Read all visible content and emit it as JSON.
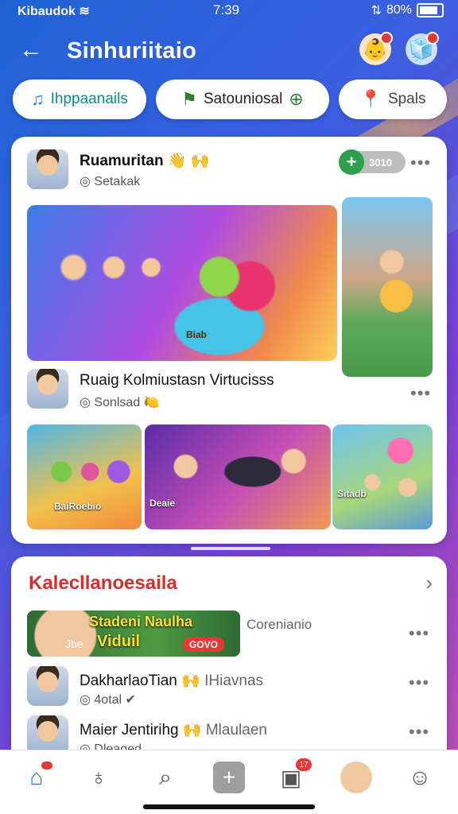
{
  "status_bar": {
    "carrier": "Kibaudok",
    "time": "7:39",
    "battery": "80%"
  },
  "header": {
    "back_icon": "arrow-left-icon",
    "title": "Sinhuriitaio"
  },
  "pills": [
    {
      "label": "Ihppaanails",
      "icon": "music-note-icon"
    },
    {
      "label": "Satouniosal",
      "icon": "compass-icon"
    },
    {
      "label": "Spals",
      "icon": "pin-icon"
    }
  ],
  "post1": {
    "name": "Ruamuritan",
    "emoji": "👋 🙌",
    "subtitle": "Setakak",
    "follow_label": "3010",
    "more": "•••",
    "image_label": "Biab"
  },
  "post2": {
    "name": "Ruaig Kolmiustasn Virtucisss",
    "subtitle": "Sonlsad",
    "emoji": "🍋",
    "more": "•••",
    "images": [
      {
        "label": "BaiRoebio"
      },
      {
        "label": "Deaie"
      },
      {
        "label": "Sitadb"
      }
    ]
  },
  "section": {
    "title": "Kalecllanoesaila",
    "banner": {
      "title_line1": "Stadeni Naulha",
      "title_line2": "Viduil",
      "small": "Jbe",
      "badge": "GOVO"
    },
    "banner_caption": "Corenianio",
    "items": [
      {
        "name": "DakharlaoTian",
        "emoji": "🙌",
        "extra": "IHiavnas",
        "subtitle": "4otal",
        "more": "•••"
      },
      {
        "name": "Maier Jentirihg",
        "emoji": "🙌",
        "extra": "Mlaulaen",
        "subtitle": "Dleaged",
        "more": "•••"
      }
    ]
  },
  "bottom_nav": {
    "items": [
      {
        "icon": "home-icon",
        "badge": ""
      },
      {
        "icon": "tooth-icon",
        "badge": ""
      },
      {
        "icon": "search-icon",
        "badge": ""
      },
      {
        "icon": "add-icon",
        "badge": ""
      },
      {
        "icon": "calendar-icon",
        "badge": "17"
      },
      {
        "icon": "avatar-icon",
        "badge": ""
      },
      {
        "icon": "profile-icon",
        "badge": ""
      }
    ]
  }
}
